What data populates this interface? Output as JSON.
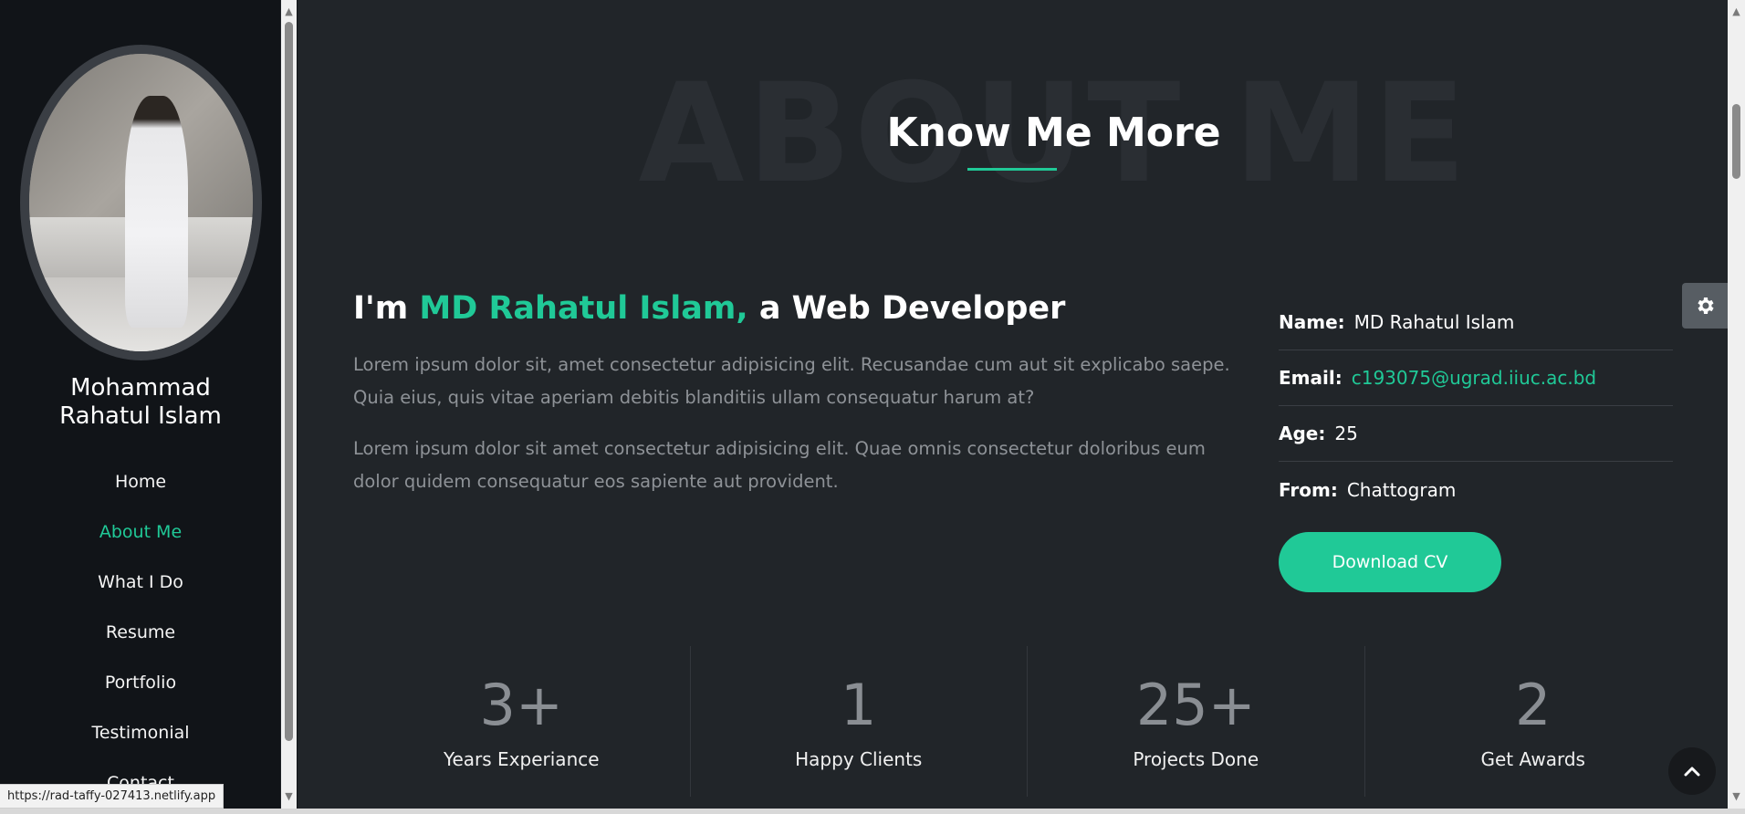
{
  "sidebar": {
    "name_line1": "Mohammad",
    "name_line2": "Rahatul Islam",
    "nav": [
      {
        "label": "Home",
        "active": false
      },
      {
        "label": "About Me",
        "active": true
      },
      {
        "label": "What I Do",
        "active": false
      },
      {
        "label": "Resume",
        "active": false
      },
      {
        "label": "Portfolio",
        "active": false
      },
      {
        "label": "Testimonial",
        "active": false
      },
      {
        "label": "Contact",
        "active": false
      }
    ]
  },
  "about": {
    "bg_title": "ABOUT ME",
    "title": "Know Me More",
    "intro_prefix": "I'm ",
    "intro_name": "MD Rahatul Islam,",
    "intro_suffix": " a Web Developer",
    "para1": "Lorem ipsum dolor sit, amet consectetur adipisicing elit. Recusandae cum aut sit explicabo saepe. Quia eius, quis vitae aperiam debitis blanditiis ullam consequatur harum at?",
    "para2": "Lorem ipsum dolor sit amet consectetur adipisicing elit. Quae omnis consectetur doloribus eum dolor quidem consequatur eos sapiente aut provident."
  },
  "info": {
    "name_key": "Name:",
    "name_val": "MD Rahatul Islam",
    "email_key": "Email:",
    "email_val": "c193075@ugrad.iiuc.ac.bd",
    "age_key": "Age:",
    "age_val": "25",
    "from_key": "From:",
    "from_val": "Chattogram",
    "cv_label": "Download CV"
  },
  "stats": [
    {
      "num": "3+",
      "label": "Years Experiance"
    },
    {
      "num": "1",
      "label": "Happy Clients"
    },
    {
      "num": "25+",
      "label": "Projects Done"
    },
    {
      "num": "2",
      "label": "Get Awards"
    }
  ],
  "status_url": "https://rad-taffy-027413.netlify.app",
  "icons": {
    "settings": "gear-icon",
    "back_to_top": "chevron-up-icon"
  },
  "colors": {
    "accent": "#20c997",
    "sidebar_bg": "#111418",
    "main_bg": "#212529"
  }
}
